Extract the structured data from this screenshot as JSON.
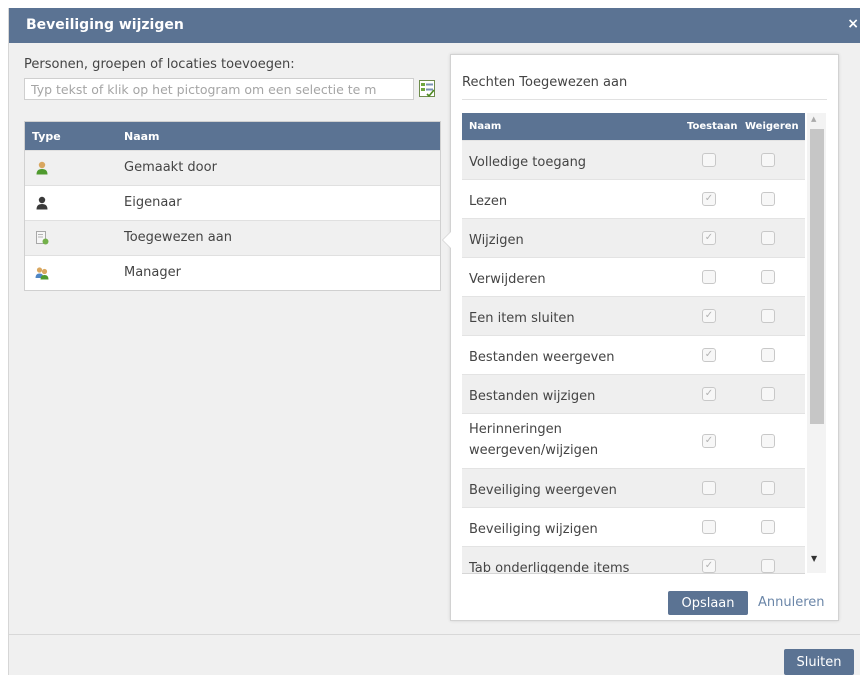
{
  "dialog": {
    "title": "Beveiliging wijzigen",
    "close_glyph": "×"
  },
  "add_section": {
    "label": "Personen, groepen of locaties toevoegen:",
    "placeholder": "Typ tekst of klik op het pictogram om een selectie te m",
    "picker_icon": "checklist-picker-icon"
  },
  "type_table": {
    "columns": [
      "Type",
      "Naam"
    ],
    "rows": [
      {
        "icon": "user-green-icon",
        "name": "Gemaakt door",
        "shaded": true
      },
      {
        "icon": "user-dark-icon",
        "name": "Eigenaar",
        "shaded": false
      },
      {
        "icon": "assigned-doc-icon",
        "name": "Toegewezen aan",
        "shaded": true
      },
      {
        "icon": "group-icon",
        "name": "Manager",
        "shaded": false
      }
    ]
  },
  "rights_panel": {
    "title": "Rechten Toegewezen aan",
    "columns": [
      "Naam",
      "Toestaan",
      "Weigeren"
    ],
    "rows": [
      {
        "name": "Volledige toegang",
        "allow": false,
        "deny": false
      },
      {
        "name": "Lezen",
        "allow": true,
        "deny": false
      },
      {
        "name": "Wijzigen",
        "allow": true,
        "deny": false
      },
      {
        "name": "Verwijderen",
        "allow": false,
        "deny": false
      },
      {
        "name": "Een item sluiten",
        "allow": true,
        "deny": false
      },
      {
        "name": "Bestanden weergeven",
        "allow": true,
        "deny": false
      },
      {
        "name": "Bestanden wijzigen",
        "allow": true,
        "deny": false
      },
      {
        "name": "Herinneringen weergeven/wijzigen",
        "allow": true,
        "deny": false,
        "tall": true
      },
      {
        "name": "Beveiliging weergeven",
        "allow": false,
        "deny": false
      },
      {
        "name": "Beveiliging wijzigen",
        "allow": false,
        "deny": false
      },
      {
        "name": "Tab onderliggende items",
        "allow": true,
        "deny": false
      }
    ],
    "save_label": "Opslaan",
    "cancel_label": "Annuleren"
  },
  "footer": {
    "close_label": "Sluiten"
  },
  "colors": {
    "header": "#5b7393",
    "link": "#6b86a8"
  }
}
